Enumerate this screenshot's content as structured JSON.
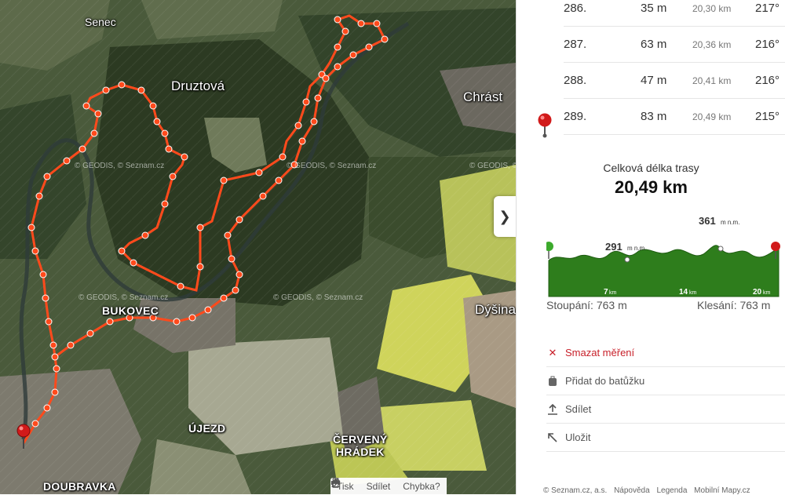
{
  "map": {
    "places": {
      "senec": "Senec",
      "druztova": "Druztová",
      "chrast": "Chrást",
      "bukovec": "BUKOVEC",
      "dysina": "Dýšina",
      "ujezd": "ÚJEZD",
      "cerveny_hradek_1": "ČERVENÝ",
      "cerveny_hradek_2": "HRÁDEK",
      "doubravka": "DOUBRAVKA"
    },
    "watermark": "© GEODIS, © Seznam.cz",
    "route_color": "#ff4a1c",
    "toolbar": {
      "print": "Tisk",
      "share": "Sdílet",
      "report": "Chybka?"
    }
  },
  "panel": {
    "collapse_glyph": "❯",
    "segments": [
      {
        "idx": "286.",
        "dist": "35 m",
        "total": "20,30 km",
        "dir": "217°"
      },
      {
        "idx": "287.",
        "dist": "63 m",
        "total": "20,36 km",
        "dir": "216°"
      },
      {
        "idx": "288.",
        "dist": "47 m",
        "total": "20,41 km",
        "dir": "216°"
      },
      {
        "idx": "289.",
        "dist": "83 m",
        "total": "20,49 km",
        "dir": "215°"
      }
    ],
    "summary": {
      "label": "Celková délka trasy",
      "value": "20,49 km"
    },
    "profile": {
      "min_label": "291",
      "max_label": "361",
      "unit": "m n.m.",
      "ticks": [
        "7",
        "14",
        "20"
      ],
      "tick_unit": "km",
      "fill_color": "#2e7d1c"
    },
    "climb": "Stoupání: 763 m",
    "descent": "Klesání: 763 m",
    "actions": {
      "delete": "Smazat měření",
      "backpack": "Přidat do batůžku",
      "share": "Sdílet",
      "save": "Uložit"
    },
    "footer": {
      "copyright": "© Seznam.cz, a.s.",
      "help": "Nápověda",
      "legend": "Legenda",
      "mobile": "Mobilní Mapy.cz"
    }
  }
}
